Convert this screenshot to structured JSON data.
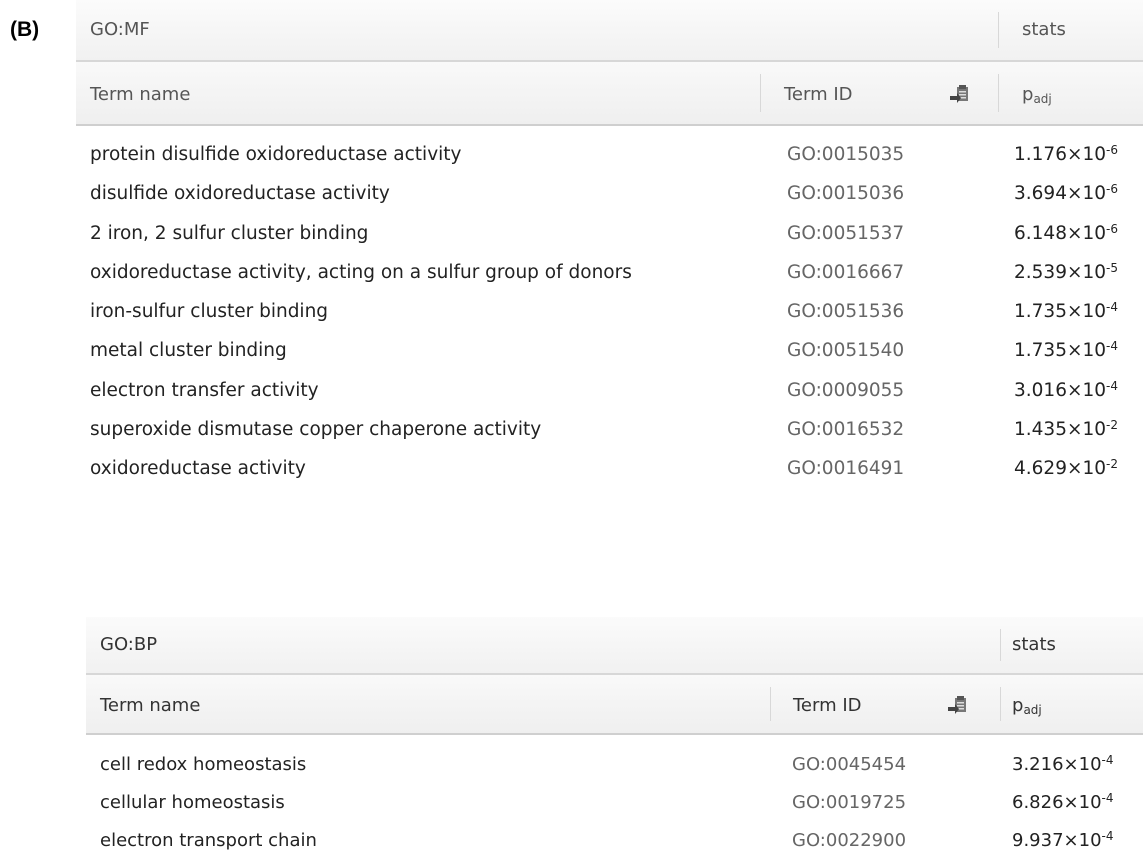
{
  "panel_label": "(B)",
  "tables": [
    {
      "section": "GO:MF",
      "stats_label": "stats",
      "columns": {
        "term_name": "Term name",
        "term_id": "Term ID",
        "padj_base": "p",
        "padj_sub": "adj"
      },
      "export_icon": "export-icon",
      "rows": [
        {
          "name": "protein disulfide oxidoreductase activity",
          "id": "GO:0015035",
          "p_mant": "1.176×10",
          "p_exp": "-6"
        },
        {
          "name": "disulfide oxidoreductase activity",
          "id": "GO:0015036",
          "p_mant": "3.694×10",
          "p_exp": "-6"
        },
        {
          "name": "2 iron, 2 sulfur cluster binding",
          "id": "GO:0051537",
          "p_mant": "6.148×10",
          "p_exp": "-6"
        },
        {
          "name": "oxidoreductase activity, acting on a sulfur group of donors",
          "id": "GO:0016667",
          "p_mant": "2.539×10",
          "p_exp": "-5"
        },
        {
          "name": "iron-sulfur cluster binding",
          "id": "GO:0051536",
          "p_mant": "1.735×10",
          "p_exp": "-4"
        },
        {
          "name": "metal cluster binding",
          "id": "GO:0051540",
          "p_mant": "1.735×10",
          "p_exp": "-4"
        },
        {
          "name": "electron transfer activity",
          "id": "GO:0009055",
          "p_mant": "3.016×10",
          "p_exp": "-4"
        },
        {
          "name": "superoxide dismutase copper chaperone activity",
          "id": "GO:0016532",
          "p_mant": "1.435×10",
          "p_exp": "-2"
        },
        {
          "name": "oxidoreductase activity",
          "id": "GO:0016491",
          "p_mant": "4.629×10",
          "p_exp": "-2"
        }
      ]
    },
    {
      "section": "GO:BP",
      "stats_label": "stats",
      "columns": {
        "term_name": "Term name",
        "term_id": "Term ID",
        "padj_base": "p",
        "padj_sub": "adj"
      },
      "export_icon": "export-icon",
      "rows": [
        {
          "name": "cell redox homeostasis",
          "id": "GO:0045454",
          "p_mant": "3.216×10",
          "p_exp": "-4"
        },
        {
          "name": "cellular homeostasis",
          "id": "GO:0019725",
          "p_mant": "6.826×10",
          "p_exp": "-4"
        },
        {
          "name": "electron transport chain",
          "id": "GO:0022900",
          "p_mant": "9.937×10",
          "p_exp": "-4"
        }
      ]
    }
  ]
}
